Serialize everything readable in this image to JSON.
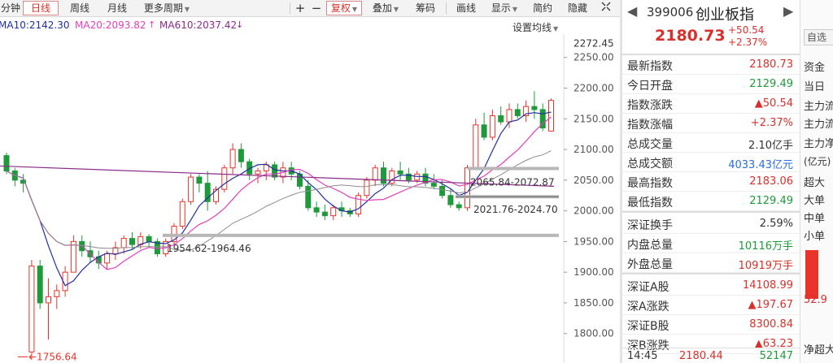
{
  "toolbar": {
    "items": [
      "分钟",
      "日线",
      "周线",
      "月线",
      "更多周期",
      "+",
      "−",
      "复权",
      "叠加",
      "筹码",
      "画线",
      "显示",
      "简约",
      "隐藏"
    ],
    "selected": "日线"
  },
  "ma_legend": {
    "ma10": "MA10:2142.30",
    "ma20": "MA20:2093.82",
    "ma610": "MA610:2037.42",
    "setting_label": "设置均线"
  },
  "colors": {
    "up": "#e8342b",
    "down": "#1f9a3a",
    "ma10": "#1f2f9f",
    "ma20": "#e23fbd",
    "ma610": "#8a2b8a",
    "ma_gray": "#8c8c8c"
  },
  "chart_data": {
    "type": "candlestick",
    "y_ticks": [
      1800,
      1850,
      1900,
      1950,
      2000,
      2050,
      2100,
      2150,
      2200,
      2250
    ],
    "y_top_label": "2272.45",
    "ylim": [
      1752,
      2288
    ],
    "annotations": {
      "low": "1756.64",
      "box1": "1954.62-1964.46",
      "box2": "2021.76-2024.70",
      "box3": "2065.84-2072.87"
    },
    "candles": [
      [
        2090,
        2095,
        2060,
        2065
      ],
      [
        2065,
        2070,
        2040,
        2050
      ],
      [
        2050,
        2060,
        2030,
        2045
      ],
      [
        1770,
        1920,
        1757,
        1910
      ],
      [
        1910,
        1920,
        1840,
        1850
      ],
      [
        1850,
        1890,
        1790,
        1860
      ],
      [
        1860,
        1880,
        1840,
        1870
      ],
      [
        1870,
        1910,
        1860,
        1900
      ],
      [
        1900,
        1960,
        1900,
        1950
      ],
      [
        1950,
        1960,
        1925,
        1935
      ],
      [
        1935,
        1950,
        1915,
        1925
      ],
      [
        1925,
        1935,
        1905,
        1915
      ],
      [
        1915,
        1935,
        1905,
        1930
      ],
      [
        1930,
        1950,
        1920,
        1940
      ],
      [
        1940,
        1960,
        1930,
        1955
      ],
      [
        1955,
        1965,
        1938,
        1945
      ],
      [
        1945,
        1965,
        1938,
        1958
      ],
      [
        1958,
        1962,
        1942,
        1950
      ],
      [
        1950,
        1955,
        1925,
        1930
      ],
      [
        1930,
        1955,
        1925,
        1950
      ],
      [
        1950,
        1980,
        1945,
        1975
      ],
      [
        1975,
        2020,
        1970,
        2015
      ],
      [
        2015,
        2060,
        2010,
        2055
      ],
      [
        2055,
        2060,
        2030,
        2045
      ],
      [
        2045,
        2065,
        2000,
        2015
      ],
      [
        2015,
        2040,
        2010,
        2035
      ],
      [
        2035,
        2075,
        2030,
        2070
      ],
      [
        2070,
        2110,
        2060,
        2100
      ],
      [
        2100,
        2110,
        2070,
        2080
      ],
      [
        2080,
        2085,
        2050,
        2060
      ],
      [
        2060,
        2070,
        2045,
        2065
      ],
      [
        2065,
        2080,
        2050,
        2075
      ],
      [
        2075,
        2080,
        2050,
        2055
      ],
      [
        2055,
        2080,
        2045,
        2070
      ],
      [
        2070,
        2080,
        2050,
        2060
      ],
      [
        2060,
        2065,
        2035,
        2040
      ],
      [
        2040,
        2050,
        2000,
        2005
      ],
      [
        2005,
        2015,
        1990,
        1998
      ],
      [
        1998,
        2010,
        1985,
        1992
      ],
      [
        1992,
        2010,
        1985,
        2005
      ],
      [
        2005,
        2015,
        1990,
        2000
      ],
      [
        2000,
        2005,
        1990,
        1995
      ],
      [
        1995,
        2030,
        1990,
        2025
      ],
      [
        2025,
        2055,
        2020,
        2050
      ],
      [
        2050,
        2075,
        2040,
        2070
      ],
      [
        2070,
        2080,
        2040,
        2045
      ],
      [
        2045,
        2070,
        2040,
        2065
      ],
      [
        2065,
        2080,
        2050,
        2060
      ],
      [
        2060,
        2070,
        2045,
        2050
      ],
      [
        2050,
        2065,
        2045,
        2060
      ],
      [
        2060,
        2070,
        2040,
        2045
      ],
      [
        2045,
        2060,
        2035,
        2040
      ],
      [
        2040,
        2050,
        2020,
        2025
      ],
      [
        2025,
        2035,
        2005,
        2010
      ],
      [
        2010,
        2015,
        2000,
        2005
      ],
      [
        2005,
        2075,
        2000,
        2070
      ],
      [
        2070,
        2150,
        2070,
        2140
      ],
      [
        2140,
        2160,
        2115,
        2120
      ],
      [
        2120,
        2165,
        2115,
        2155
      ],
      [
        2155,
        2170,
        2140,
        2145
      ],
      [
        2145,
        2175,
        2135,
        2165
      ],
      [
        2165,
        2175,
        2150,
        2155
      ],
      [
        2155,
        2180,
        2145,
        2170
      ],
      [
        2170,
        2195,
        2150,
        2165
      ],
      [
        2165,
        2175,
        2130,
        2135
      ],
      [
        2130,
        2183,
        2129,
        2180
      ]
    ]
  },
  "quote": {
    "code": "399006",
    "name": "创业板指",
    "price": "2180.73",
    "change": "+50.54",
    "change_pct": "+2.37%",
    "rows": [
      {
        "label": "最新指数",
        "value": "2180.73",
        "color": "#d8312b"
      },
      {
        "label": "今日开盘",
        "value": "2129.49",
        "color": "#1f9a3a"
      },
      {
        "label": "指数涨跌",
        "value": "▲50.54",
        "color": "#d8312b"
      },
      {
        "label": "指数涨幅",
        "value": "+2.37%",
        "color": "#d8312b"
      },
      {
        "label": "总成交量",
        "value": "2.10亿手",
        "color": "#333333"
      },
      {
        "label": "总成交额",
        "value": "4033.43亿元",
        "color": "#2a6fdb"
      },
      {
        "label": "最高指数",
        "value": "2183.06",
        "color": "#d8312b"
      },
      {
        "label": "最低指数",
        "value": "2129.49",
        "color": "#1f9a3a"
      },
      {
        "label": "深证换手",
        "value": "2.59%",
        "color": "#333333"
      },
      {
        "label": "内盘总量",
        "value": "10116万手",
        "color": "#1f9a3a"
      },
      {
        "label": "外盘总量",
        "value": "10919万手",
        "color": "#d8312b"
      },
      {
        "label": "深证A股",
        "value": "14108.99",
        "color": "#d8312b"
      },
      {
        "label": "深A涨跌",
        "value": "▲197.67",
        "color": "#d8312b"
      },
      {
        "label": "深证B股",
        "value": "8300.84",
        "color": "#d8312b"
      },
      {
        "label": "深B涨跌",
        "value": "▲63.23",
        "color": "#d8312b"
      }
    ],
    "footer": {
      "time": "14:45",
      "price": "2180.44",
      "volume": "52147"
    }
  },
  "side": {
    "title": "自选",
    "tab": "资金",
    "today": "当日",
    "items": [
      "主力流",
      "主力流",
      "主力净",
      "(亿元)",
      "超大",
      "大单",
      "中单",
      "小单"
    ],
    "bar_value": "52.9",
    "bottom": "净超大"
  }
}
